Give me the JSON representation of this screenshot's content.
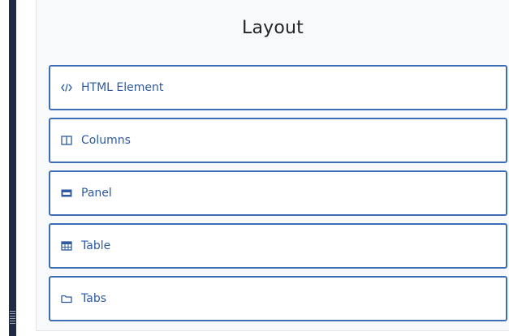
{
  "panel": {
    "title": "Layout",
    "items": [
      {
        "label": "HTML Element",
        "icon": "code-icon"
      },
      {
        "label": "Columns",
        "icon": "columns-icon"
      },
      {
        "label": "Panel",
        "icon": "panel-icon"
      },
      {
        "label": "Table",
        "icon": "table-icon"
      },
      {
        "label": "Tabs",
        "icon": "folder-icon"
      }
    ]
  },
  "colors": {
    "accent": "#2d5aa0",
    "border": "#3d6db5",
    "splitter": "#1f2a44",
    "panel_background": "#f8f9fa"
  }
}
